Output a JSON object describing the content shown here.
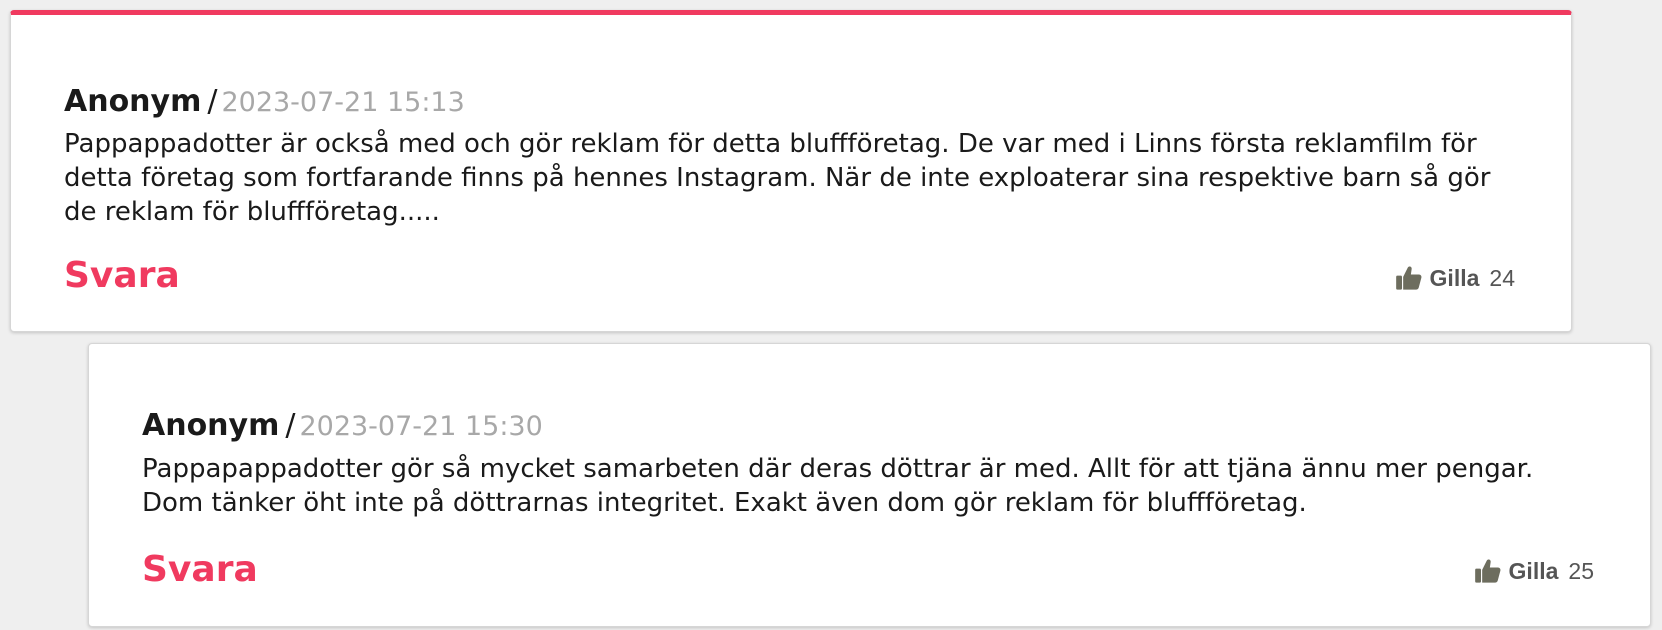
{
  "accent_color": "#f03a5f",
  "comments": [
    {
      "author": "Anonym",
      "separator": "/",
      "timestamp": "2023-07-21 15:13",
      "text": "Pappappadotter är också med och gör reklam för detta bluffföretag. De var med i Linns första reklamfilm för detta företag som fortfarande finns på hennes Instagram. När de inte exploaterar sina respektive barn så gör de reklam för bluffföretag.....",
      "reply_label": "Svara",
      "like_icon": "thumbs-up-icon",
      "like_label": "Gilla",
      "like_count": "24"
    },
    {
      "author": "Anonym",
      "separator": "/",
      "timestamp": "2023-07-21 15:30",
      "text": "Pappapappadotter gör så mycket samarbeten där deras döttrar är med. Allt för att tjäna ännu mer pengar. Dom tänker öht inte på döttrarnas integritet. Exakt även dom gör reklam för bluffföretag.",
      "reply_label": "Svara",
      "like_icon": "thumbs-up-icon",
      "like_label": "Gilla",
      "like_count": "25"
    }
  ]
}
